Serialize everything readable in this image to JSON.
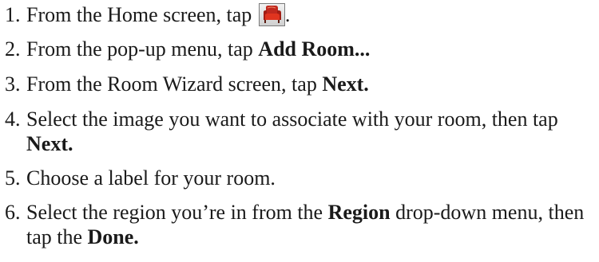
{
  "steps": [
    {
      "number": "1.",
      "before": "From the Home screen, tap ",
      "icon": "armchair-icon",
      "after": "."
    },
    {
      "number": "2.",
      "before": "From the pop-up menu, tap ",
      "bold": "Add Room..."
    },
    {
      "number": "3.",
      "before": "From the Room Wizard screen, tap ",
      "bold": "Next."
    },
    {
      "number": "4.",
      "before": "Select the image you want to associate with your room, then tap ",
      "bold": "Next."
    },
    {
      "number": "5.",
      "before": "Choose a label for your room."
    },
    {
      "number": "6.",
      "before": "Select the region you’re in from the ",
      "bold": "Region",
      "middle": " drop-down menu, then tap the ",
      "bold2": "Done."
    }
  ]
}
